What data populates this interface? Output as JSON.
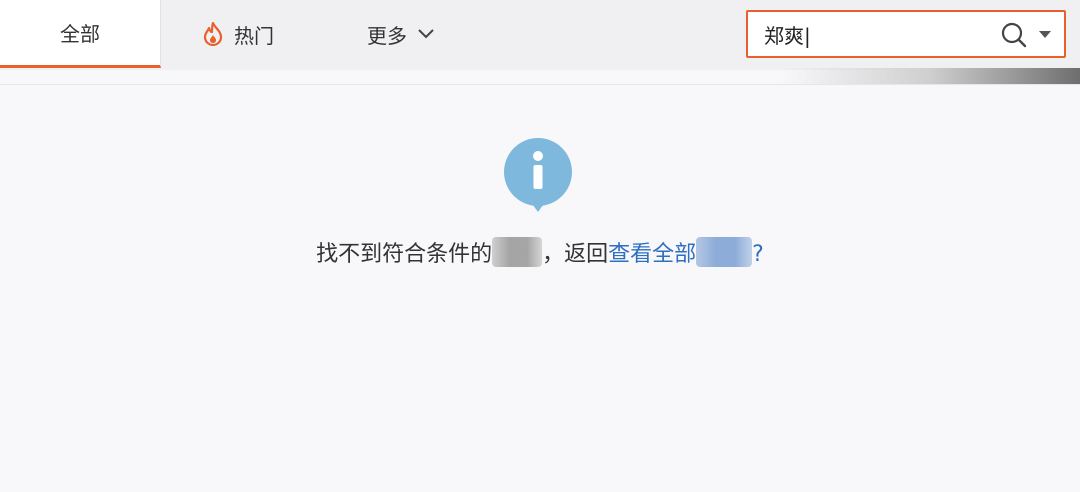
{
  "tabs": {
    "all": "全部",
    "hot": "热门",
    "more": "更多"
  },
  "search": {
    "value": "郑爽|"
  },
  "message": {
    "prefix": "找不到符合条件的",
    "middle": "，返回",
    "link": "查看全部",
    "suffix": "?"
  },
  "colors": {
    "accent": "#e8602c",
    "info": "#7fb8dd",
    "link": "#2f6fc1"
  },
  "icons": {
    "hot": "flame-icon",
    "more": "chevron-down-icon",
    "search": "search-icon",
    "dropdown": "caret-down-icon",
    "notice": "info-icon"
  }
}
